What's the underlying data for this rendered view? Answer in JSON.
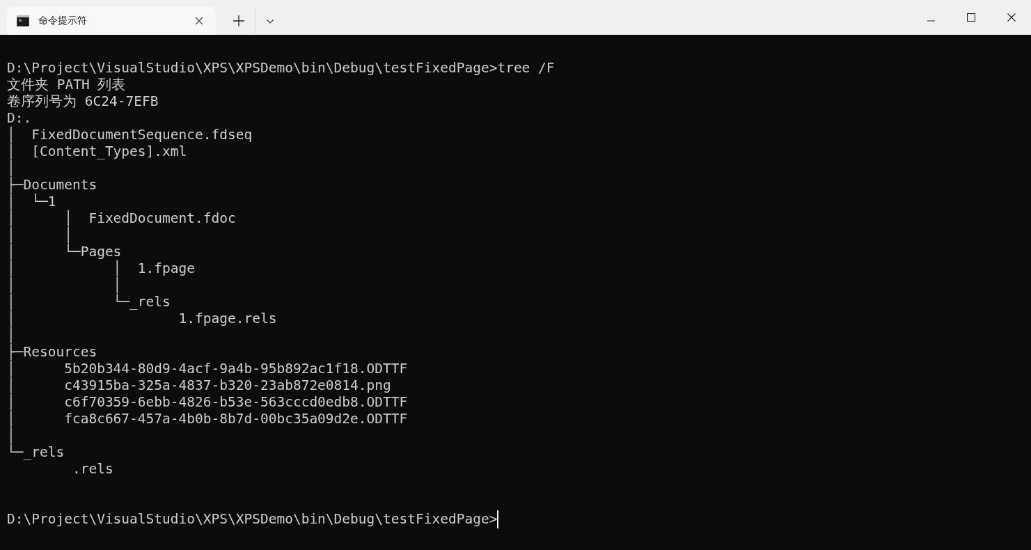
{
  "tabs": [
    {
      "title": "命令提示符",
      "selected": true
    }
  ],
  "terminal": {
    "lines": [
      {
        "kind": "blank"
      },
      {
        "kind": "text",
        "text": "D:\\Project\\VisualStudio\\XPS\\XPSDemo\\bin\\Debug\\testFixedPage>tree /F"
      },
      {
        "kind": "text",
        "text": "文件夹 PATH 列表"
      },
      {
        "kind": "text",
        "text": "卷序列号为 6C24-7EFB"
      },
      {
        "kind": "text",
        "text": "D:."
      },
      {
        "kind": "text",
        "text": "│  FixedDocumentSequence.fdseq"
      },
      {
        "kind": "text",
        "text": "│  [Content_Types].xml"
      },
      {
        "kind": "text",
        "text": "│"
      },
      {
        "kind": "text",
        "text": "├─Documents"
      },
      {
        "kind": "text",
        "text": "│  └─1"
      },
      {
        "kind": "text",
        "text": "│      │  FixedDocument.fdoc"
      },
      {
        "kind": "text",
        "text": "│      │"
      },
      {
        "kind": "text",
        "text": "│      └─Pages"
      },
      {
        "kind": "text",
        "text": "│            │  1.fpage"
      },
      {
        "kind": "text",
        "text": "│            │"
      },
      {
        "kind": "text",
        "text": "│            └─_rels"
      },
      {
        "kind": "text",
        "text": "│                    1.fpage.rels"
      },
      {
        "kind": "text",
        "text": "│"
      },
      {
        "kind": "text",
        "text": "├─Resources"
      },
      {
        "kind": "text",
        "text": "│      5b20b344-80d9-4acf-9a4b-95b892ac1f18.ODTTF"
      },
      {
        "kind": "text",
        "text": "│      c43915ba-325a-4837-b320-23ab872e0814.png"
      },
      {
        "kind": "text",
        "text": "│      c6f70359-6ebb-4826-b53e-563cccd0edb8.ODTTF"
      },
      {
        "kind": "text",
        "text": "│      fca8c667-457a-4b0b-8b7d-00bc35a09d2e.ODTTF"
      },
      {
        "kind": "text",
        "text": "│"
      },
      {
        "kind": "text",
        "text": "└─_rels"
      },
      {
        "kind": "text",
        "text": "        .rels"
      },
      {
        "kind": "blank"
      },
      {
        "kind": "blank"
      },
      {
        "kind": "prompt",
        "text": "D:\\Project\\VisualStudio\\XPS\\XPSDemo\\bin\\Debug\\testFixedPage>"
      }
    ]
  }
}
